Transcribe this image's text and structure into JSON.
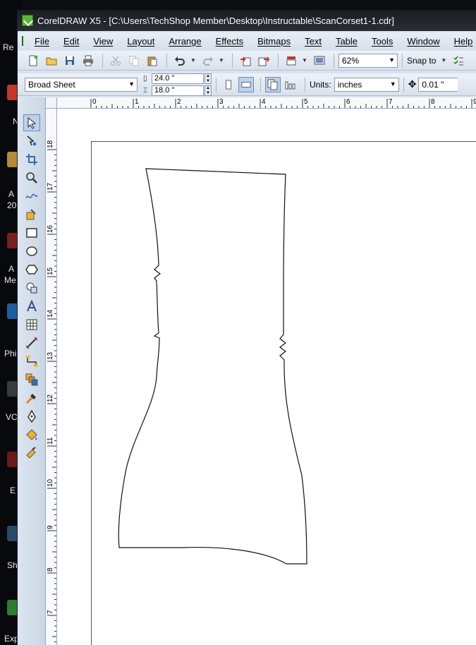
{
  "desktop": {
    "labels": [
      "Re",
      "N",
      "A",
      "20",
      "A",
      "Me",
      "Phi",
      "VC",
      "E",
      "Sh",
      "Exp"
    ]
  },
  "window": {
    "title": "CorelDRAW X5 - [C:\\Users\\TechShop Member\\Desktop\\Instructable\\ScanCorset1-1.cdr]"
  },
  "menu": [
    "File",
    "Edit",
    "View",
    "Layout",
    "Arrange",
    "Effects",
    "Bitmaps",
    "Text",
    "Table",
    "Tools",
    "Window",
    "Help"
  ],
  "standard_toolbar": {
    "zoom_level": "62%",
    "snap_label": "Snap to"
  },
  "property_bar": {
    "page_size": "Broad Sheet",
    "page_width": "24.0 \"",
    "page_height": "18.0 \"",
    "units_label": "Units:",
    "units_value": "inches",
    "nudge": "0.01 \""
  },
  "ruler": {
    "horizontal_labels": [
      "0",
      "1",
      "2",
      "3",
      "4",
      "5",
      "6",
      "7",
      "8",
      "9"
    ],
    "vertical_labels": [
      "18",
      "17",
      "16",
      "15",
      "14",
      "13",
      "12",
      "11",
      "10",
      "9",
      "8",
      "7"
    ]
  },
  "tools": [
    "pick-tool",
    "shape-tool",
    "crop-tool",
    "zoom-tool",
    "freehand-tool",
    "smart-fill-tool",
    "rectangle-tool",
    "ellipse-tool",
    "polygon-tool",
    "basic-shapes-tool",
    "text-tool",
    "table-tool",
    "dimension-tool",
    "connector-tool",
    "blend-tool",
    "eyedropper-tool",
    "outline-tool",
    "fill-tool",
    "interactive-fill-tool"
  ],
  "colors": {
    "titlebar": "#1a1d22",
    "chrome": "#d9e2ee",
    "canvas": "#ffffff",
    "accent": "#5fb33a"
  }
}
